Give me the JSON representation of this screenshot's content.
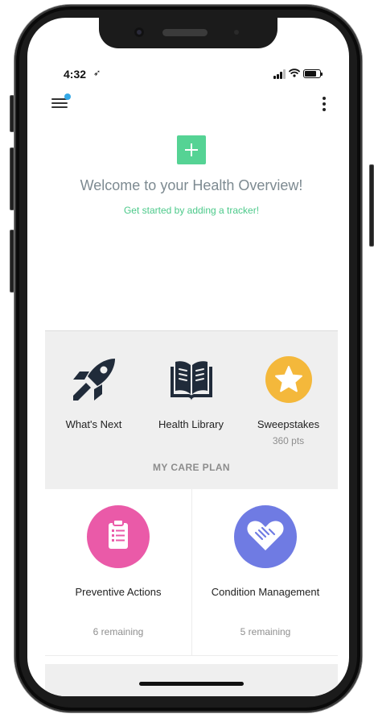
{
  "status_bar": {
    "time": "4:32",
    "location_arrow": "➶"
  },
  "top_bar": {
    "menu_icon": "hamburger-menu-icon",
    "more_icon": "vertical-dots-icon",
    "notification_dot_color": "#34a8e6"
  },
  "overview": {
    "title": "Welcome to your Health Overview!",
    "subtitle": "Get started by adding a tracker!",
    "add_icon": "plus-icon",
    "accent_color": "#55d394"
  },
  "quick_links": [
    {
      "label": "What's Next",
      "icon": "rocket-icon"
    },
    {
      "label": "Health Library",
      "icon": "open-book-icon"
    },
    {
      "label": "Sweepstakes",
      "sublabel": "360 pts",
      "icon": "star-icon"
    }
  ],
  "care_plan": {
    "heading": "MY CARE PLAN",
    "cards": [
      {
        "title": "Preventive Actions",
        "count": "6 remaining",
        "icon": "clipboard-icon",
        "color": "#ea5aa8"
      },
      {
        "title": "Condition Management",
        "count": "5 remaining",
        "icon": "handshake-heart-icon",
        "color": "#6f7be3"
      }
    ]
  }
}
